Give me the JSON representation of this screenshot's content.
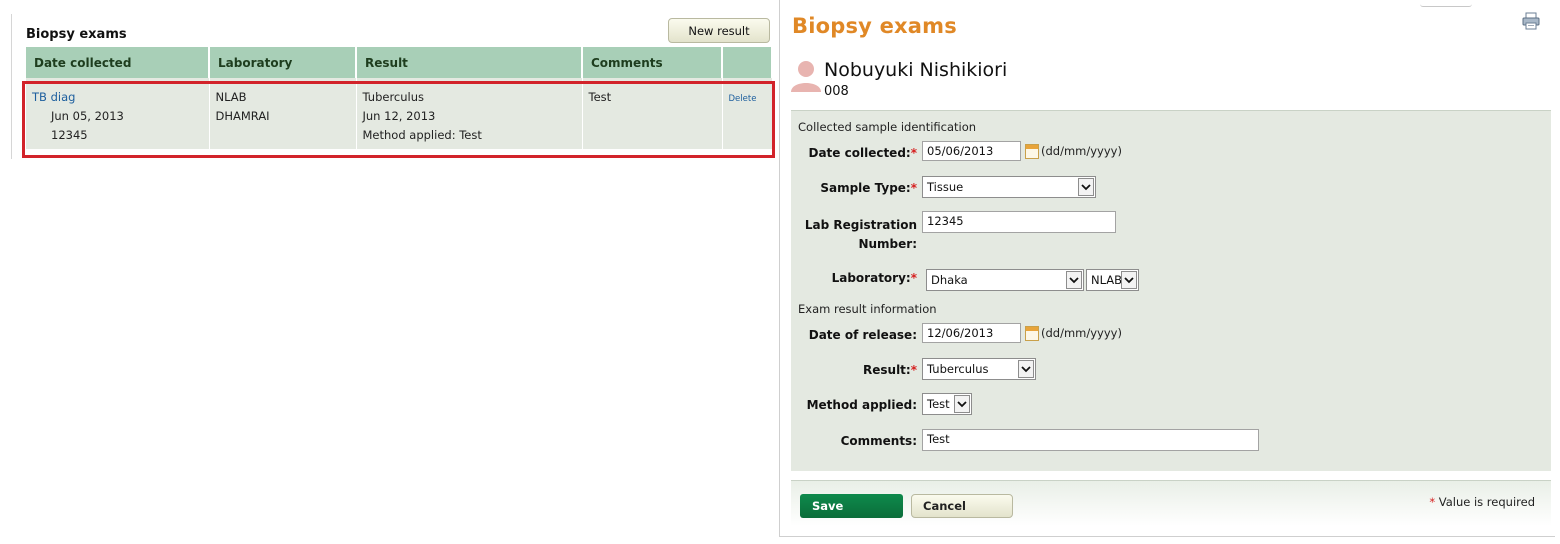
{
  "left": {
    "title": "Biopsy exams",
    "new_result_label": "New result",
    "table": {
      "headers": [
        "Date collected",
        "Laboratory",
        "Result",
        "Comments",
        ""
      ],
      "rows": [
        {
          "exam_name": "TB diag",
          "date_collected": "Jun 05, 2013",
          "lab_number": "12345",
          "laboratory_code": "NLAB",
          "laboratory_name": "DHAMRAI",
          "result": "Tuberculus",
          "release_date": "Jun 12, 2013",
          "method": "Method applied: Test",
          "comments": "Test",
          "delete_label": "Delete"
        }
      ]
    }
  },
  "right": {
    "title": "Biopsy exams",
    "print_icon": "printer-icon",
    "patient": {
      "name": "Nobuyuki Nishikiori",
      "id": "008",
      "avatar_icon": "person-icon"
    },
    "form": {
      "section_collected": "Collected sample identification",
      "section_result": "Exam result information",
      "date_collected": {
        "label": "Date collected:",
        "value": "05/06/2013",
        "format": "(dd/mm/yyyy)"
      },
      "sample_type": {
        "label": "Sample Type:",
        "value": "Tissue"
      },
      "lab_registration": {
        "label_line1": "Lab Registration",
        "label_line2": "Number:",
        "value": "12345"
      },
      "laboratory": {
        "label": "Laboratory:",
        "value": "Dhaka",
        "sub_value": "NLAB"
      },
      "date_release": {
        "label": "Date of release:",
        "value": "12/06/2013",
        "format": "(dd/mm/yyyy)"
      },
      "result": {
        "label": "Result:",
        "value": "Tuberculus"
      },
      "method": {
        "label": "Method applied:",
        "value": "Test"
      },
      "comments": {
        "label": "Comments:",
        "value": "Test"
      },
      "required_marker": "*"
    },
    "buttons": {
      "save": "Save",
      "cancel": "Cancel",
      "required_note": "Value is required"
    }
  },
  "colors": {
    "accent_orange": "#e08826",
    "table_header": "#a8cfb7",
    "row_bg": "#e4e9e1",
    "highlight": "#d2232a",
    "save_green": "#0b6d3a"
  }
}
